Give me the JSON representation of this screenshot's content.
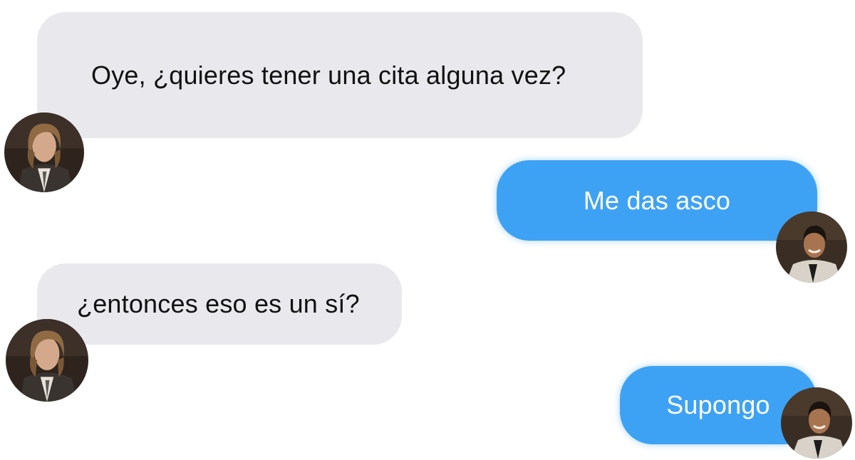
{
  "conversation": {
    "messages": [
      {
        "direction": "incoming",
        "text": "Oye, ¿quieres tener una cita alguna vez?",
        "avatar_icon": "long-haired-man-in-suit-avatar"
      },
      {
        "direction": "outgoing",
        "text": "Me das asco",
        "avatar_icon": "smiling-man-in-white-suit-avatar"
      },
      {
        "direction": "incoming",
        "text": "¿entonces eso es un sí?",
        "avatar_icon": "long-haired-man-in-suit-avatar"
      },
      {
        "direction": "outgoing",
        "text": "Supongo",
        "avatar_icon": "smiling-man-in-white-suit-avatar"
      }
    ]
  },
  "colors": {
    "incoming_bubble": "#e9e9ed",
    "outgoing_bubble": "#3ea2f4",
    "incoming_text": "#111111",
    "outgoing_text": "#ffffff",
    "background": "#ffffff"
  }
}
